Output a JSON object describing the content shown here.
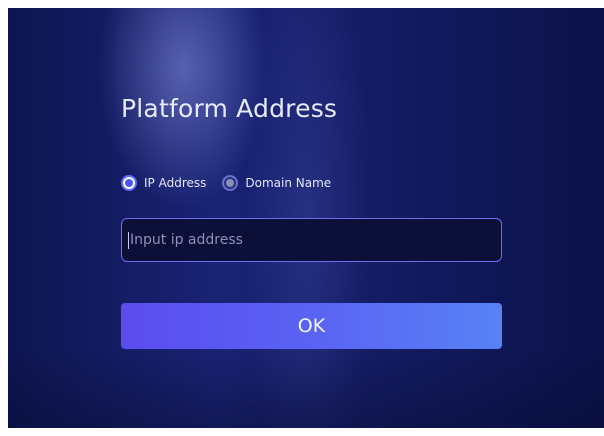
{
  "dialog": {
    "title": "Platform Address"
  },
  "address_type": {
    "options": [
      {
        "label": "IP Address",
        "selected": true
      },
      {
        "label": "Domain Name",
        "selected": false
      }
    ]
  },
  "ip_field": {
    "value": "",
    "placeholder": "Input ip address"
  },
  "actions": {
    "ok_label": "OK"
  },
  "colors": {
    "background_dark": "#0d1550",
    "background_mid": "#1a2375",
    "accent": "#5e6dff",
    "button_start": "#5b4cf0",
    "button_end": "#5882f6",
    "input_border": "#6f6cf0"
  }
}
